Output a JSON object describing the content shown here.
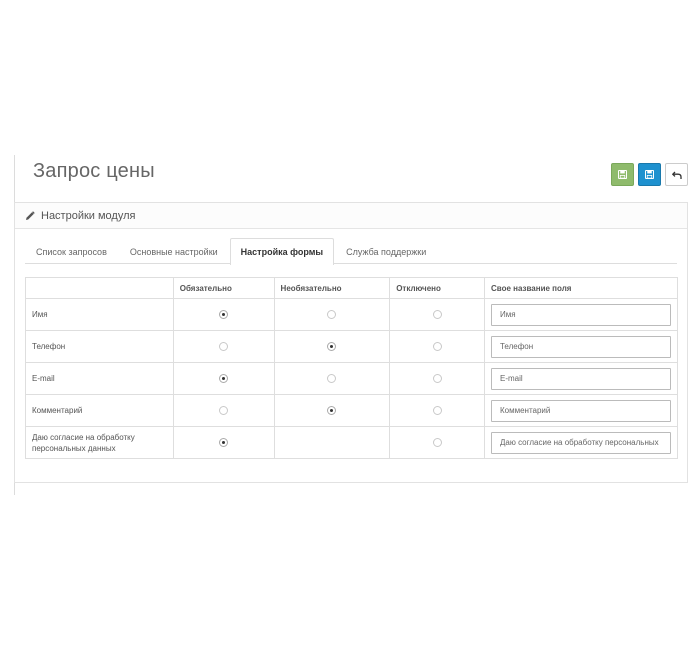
{
  "page": {
    "title": "Запрос цены"
  },
  "toolbar": {
    "buttons": [
      {
        "name": "save-stay",
        "icon": "floppy-icon",
        "color": "#8fbb6c"
      },
      {
        "name": "save",
        "icon": "floppy-icon",
        "color": "#1e91cf"
      },
      {
        "name": "back",
        "icon": "undo-arrow-icon",
        "color": "#ffffff"
      }
    ]
  },
  "panel": {
    "heading": "Настройки модуля",
    "heading_icon": "pencil-icon"
  },
  "tabs": [
    {
      "label": "Список запросов",
      "active": false
    },
    {
      "label": "Основные настройки",
      "active": false
    },
    {
      "label": "Настройка формы",
      "active": true
    },
    {
      "label": "Служба поддержки",
      "active": false
    }
  ],
  "table": {
    "headers": [
      "",
      "Обязательно",
      "Необязательно",
      "Отключено",
      "Свое название поля"
    ],
    "rows": [
      {
        "label": "Имя",
        "selected": "required",
        "show_optional": true,
        "input_value": "Имя"
      },
      {
        "label": "Телефон",
        "selected": "optional",
        "show_optional": true,
        "input_value": "Телефон"
      },
      {
        "label": "E-mail",
        "selected": "required",
        "show_optional": true,
        "input_value": "E-mail"
      },
      {
        "label": "Комментарий",
        "selected": "optional",
        "show_optional": true,
        "input_value": "Комментарий"
      },
      {
        "label": "Даю согласие на обработку персональных данных",
        "selected": "required",
        "show_optional": false,
        "input_value": "Даю согласие на обработку персональных"
      }
    ]
  }
}
